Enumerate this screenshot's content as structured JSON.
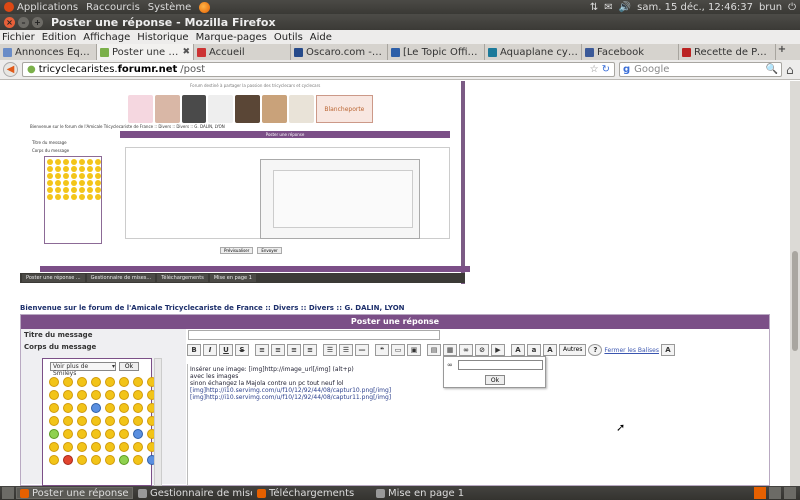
{
  "os_panel": {
    "menus": [
      "Applications",
      "Raccourcis",
      "Système"
    ],
    "clock": "sam. 15 déc., 12:46:37",
    "user": "brun"
  },
  "window": {
    "title": "Poster une réponse - Mozilla Firefox"
  },
  "menubar": [
    "Fichier",
    "Edition",
    "Affichage",
    "Historique",
    "Marque-pages",
    "Outils",
    "Aide"
  ],
  "tabs": [
    "Annonces Equipe...",
    "Poster une réponse",
    "Accueil",
    "Oscaro.com - piè...",
    "[Le Topic Officiel...",
    "Aquaplane cylind...",
    "Facebook",
    "Recette de Pâte ..."
  ],
  "navbar": {
    "url_domain": "tricyclecaristes.",
    "url_site": "forumr.net",
    "url_path": "/post",
    "search_placeholder": "Google"
  },
  "embedded": {
    "top_text": "Forum destiné à partager la passion des tricyclecars et cyclecars",
    "brand": "Blancheporte",
    "crumb": "Bienvenue sur le forum de l'Amicale Tricyclecariste de France :: Divers :: Divers :: G. DALIN, LYON",
    "header": "Poster une réponse",
    "labels": [
      "Titre du message",
      "Corps du message"
    ],
    "buttons": [
      "Prévisualiser",
      "Envoyer"
    ],
    "taskbar": [
      "Poster une réponse ...",
      "Gestionnaire de mises...",
      "Téléchargements",
      "Mise en page 1"
    ]
  },
  "forum": {
    "breadcrumb": "Bienvenue sur le forum de l'Amicale Tricyclecariste de France :: Divers :: Divers :: G. DALIN, LYON",
    "header": "Poster une réponse",
    "title_label": "Titre du message",
    "body_label": "Corps du message",
    "smiley_select": "Voir plus de Smileys",
    "smiley_ok": "Ok",
    "toolbar_autres": "Autres",
    "toolbar_close_tags": "Fermer les Balises",
    "body_lines": [
      "Insérer une image: [img]http://image_url[/img] (alt+p)",
      "avec les images",
      "sinon échangez la Majola contre un pc tout neuf lol",
      "[img]http://i10.servimg.com/u/f10/12/92/44/08/captur10.png[/img]",
      "[img]http://i10.servimg.com/u/f10/12/92/44/08/captur11.png[/img]"
    ],
    "popup_ok": "Ok"
  },
  "taskbar": [
    "Poster une réponse - ...",
    "Gestionnaire de mises...",
    "Téléchargements",
    "Mise en page 1"
  ]
}
